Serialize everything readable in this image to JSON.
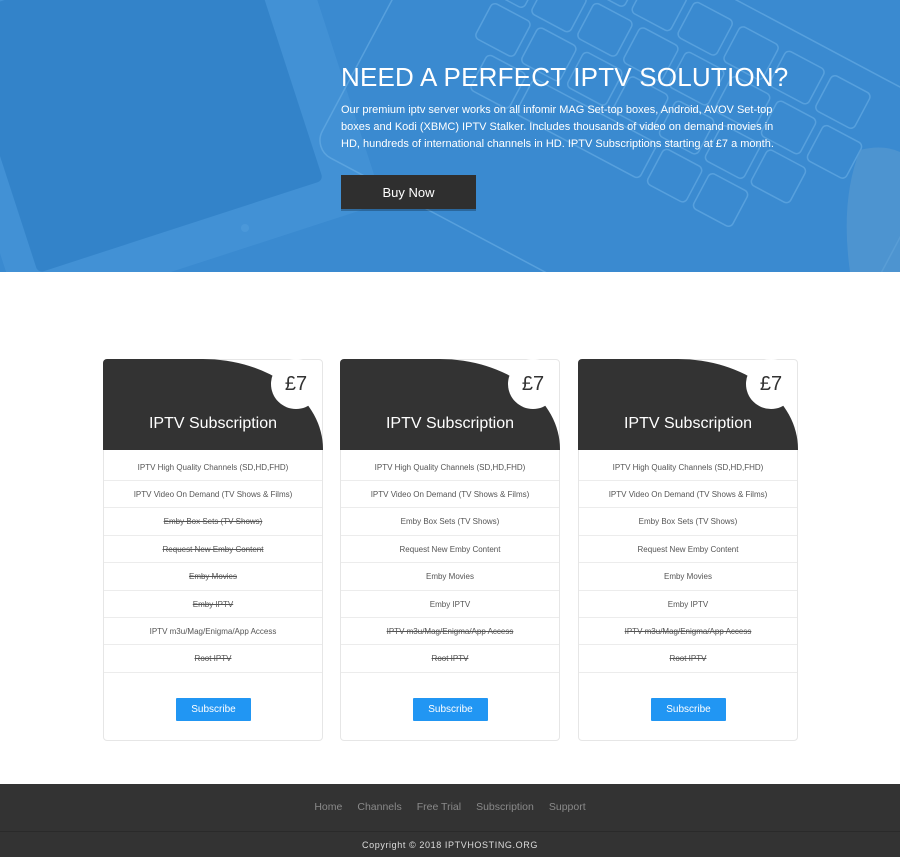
{
  "hero": {
    "title": "NEED A PERFECT IPTV SOLUTION?",
    "text": "Our premium iptv server works on all infomir MAG Set-top boxes, Android, AVOV Set-top boxes and Kodi (XBMC) IPTV Stalker. Includes thousands of video on demand movies in HD, hundreds of international channels in HD. IPTV Subscriptions starting at £7 a month.",
    "button_label": "Buy Now",
    "bg_color": "#3a8ad0"
  },
  "plans": [
    {
      "price": "£7",
      "title": "IPTV Subscription",
      "features": [
        {
          "label": "IPTV High Quality Channels (SD,HD,FHD)",
          "included": true
        },
        {
          "label": "IPTV Video On Demand (TV Shows & Films)",
          "included": true
        },
        {
          "label": "Emby Box Sets (TV Shows)",
          "included": false
        },
        {
          "label": "Request New Emby Content",
          "included": false
        },
        {
          "label": "Emby Movies",
          "included": false
        },
        {
          "label": "Emby IPTV",
          "included": false
        },
        {
          "label": "IPTV m3u/Mag/Enigma/App Access",
          "included": true
        },
        {
          "label": "Root IPTV",
          "included": false
        }
      ],
      "button_label": "Subscribe"
    },
    {
      "price": "£7",
      "title": "IPTV Subscription",
      "features": [
        {
          "label": "IPTV High Quality Channels (SD,HD,FHD)",
          "included": true
        },
        {
          "label": "IPTV Video On Demand (TV Shows & Films)",
          "included": true
        },
        {
          "label": "Emby Box Sets (TV Shows)",
          "included": true
        },
        {
          "label": "Request New Emby Content",
          "included": true
        },
        {
          "label": "Emby Movies",
          "included": true
        },
        {
          "label": "Emby IPTV",
          "included": true
        },
        {
          "label": "IPTV m3u/Mag/Enigma/App Access",
          "included": false
        },
        {
          "label": "Root IPTV",
          "included": false
        }
      ],
      "button_label": "Subscribe"
    },
    {
      "price": "£7",
      "title": "IPTV Subscription",
      "features": [
        {
          "label": "IPTV High Quality Channels (SD,HD,FHD)",
          "included": true
        },
        {
          "label": "IPTV Video On Demand (TV Shows & Films)",
          "included": true
        },
        {
          "label": "Emby Box Sets (TV Shows)",
          "included": true
        },
        {
          "label": "Request New Emby Content",
          "included": true
        },
        {
          "label": "Emby Movies",
          "included": true
        },
        {
          "label": "Emby IPTV",
          "included": true
        },
        {
          "label": "IPTV m3u/Mag/Enigma/App Access",
          "included": false
        },
        {
          "label": "Root IPTV",
          "included": false
        }
      ],
      "button_label": "Subscribe"
    }
  ],
  "footer": {
    "nav": [
      "Home",
      "Channels",
      "Free Trial",
      "Subscription",
      "Support"
    ],
    "copyright": "Copyright © 2018 IPTVHOSTING.ORG"
  },
  "colors": {
    "accent": "#2196f3",
    "dark": "#333333"
  }
}
